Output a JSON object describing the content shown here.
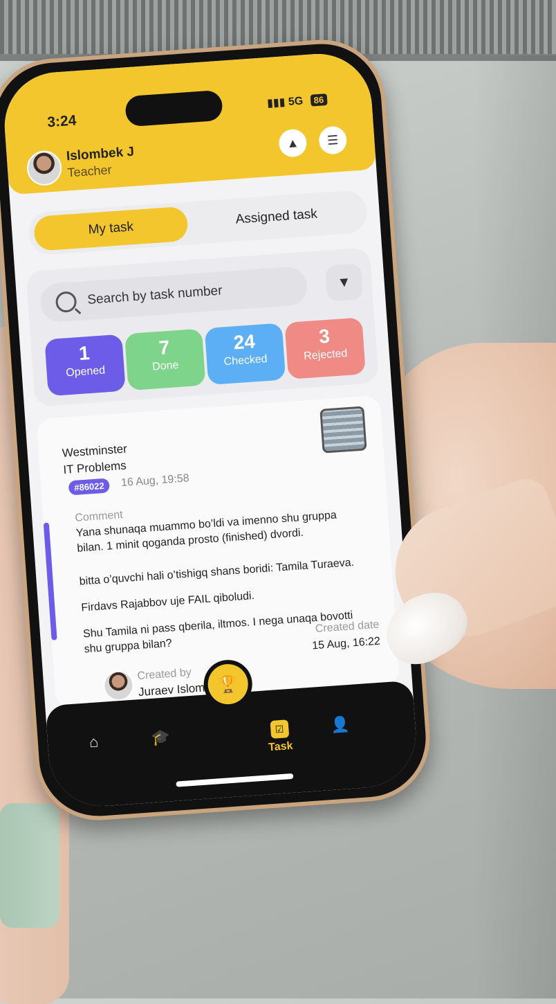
{
  "status_bar": {
    "time": "3:24",
    "network": "5G",
    "battery": "86"
  },
  "header": {
    "user_name": "Islombek J",
    "user_role": "Teacher"
  },
  "tabs": [
    {
      "label": "My task"
    },
    {
      "label": "Assigned task"
    }
  ],
  "search": {
    "placeholder": "Search by task number"
  },
  "stats": [
    {
      "count": "1",
      "label": "Opened",
      "color": "#6c5ce7"
    },
    {
      "count": "7",
      "label": "Done",
      "color": "#7ed48b"
    },
    {
      "count": "24",
      "label": "Checked",
      "color": "#5caef5"
    },
    {
      "count": "3",
      "label": "Rejected",
      "color": "#ef8a85"
    }
  ],
  "task_card": {
    "school": "Westminster",
    "category": "IT Problems",
    "id": "#86022",
    "date": "16 Aug, 19:58",
    "comment_label": "Comment",
    "comment_lines": [
      "Yana shunaqa muammo bo’ldi va imenno shu gruppa",
      "bilan. 1 minit qoganda prosto (finished) dvordi.",
      "bitta o’quvchi hali o’tishigq shans boridi: Tamila Turaeva.",
      "Firdavs Rajabbov uje FAIL qiboludi.",
      "Shu Tamila ni pass qberila, iltmos. I nega unaqa bovotti",
      "shu gruppa bilan?"
    ],
    "created_by_label": "Created by",
    "created_by": "Juraev Islombek",
    "created_date_label": "Created date",
    "created_date": "15 Aug, 16:22"
  },
  "fab": {
    "icon": "plus-icon",
    "symbol": "+"
  },
  "bottom_nav": {
    "task_label": "Task"
  },
  "colors": {
    "accent": "#f3c62d",
    "purple": "#6c5ce7"
  }
}
